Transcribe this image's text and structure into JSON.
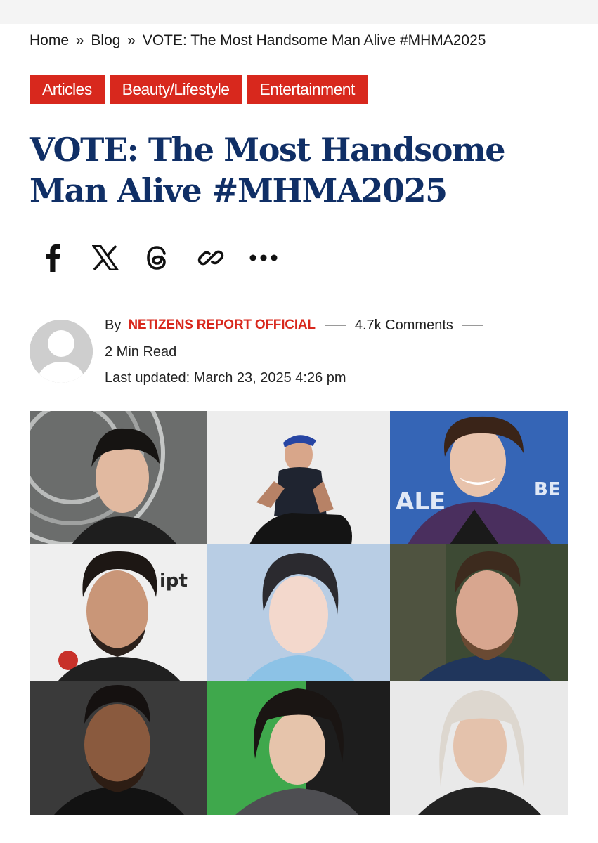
{
  "breadcrumb": {
    "home": "Home",
    "separator": "»",
    "blog": "Blog",
    "current": "VOTE: The Most Handsome Man Alive #MHMA2025"
  },
  "categories": [
    "Articles",
    "Beauty/Lifestyle",
    "Entertainment"
  ],
  "article": {
    "title_line1": "VOTE: The Most Handsome",
    "title_line2": "Man Alive #MHMA2025"
  },
  "share": {
    "icons": [
      "facebook-icon",
      "x-icon",
      "threads-icon",
      "link-icon",
      "more-icon"
    ]
  },
  "author": {
    "by_label": "By",
    "name": "NETIZENS REPORT OFFICIAL",
    "comments": "4.7k Comments",
    "read_time": "2 Min Read",
    "last_updated": "Last updated: March 23, 2025 4:26 pm"
  },
  "featured_image": {
    "grid": "3x3 photo collage",
    "cells": 9
  },
  "colors": {
    "accent_red": "#d8281d",
    "title_navy": "#102f66",
    "text": "#1b1b1b"
  }
}
